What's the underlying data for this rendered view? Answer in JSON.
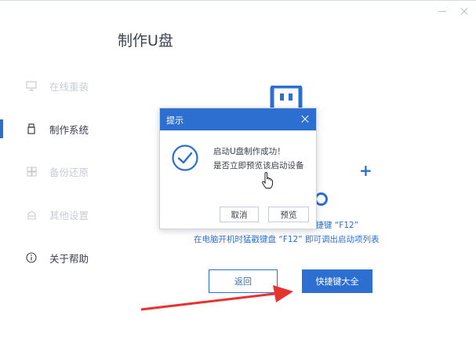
{
  "page": {
    "title": "制作U盘"
  },
  "window": {
    "minimize_icon": "minimize-icon",
    "close_icon": "close-icon"
  },
  "sidebar": {
    "items": [
      {
        "label": "在线重装",
        "icon": "monitor-icon",
        "active": false
      },
      {
        "label": "制作系统",
        "icon": "usb-icon",
        "active": true
      },
      {
        "label": "备份还原",
        "icon": "backup-icon",
        "active": false
      },
      {
        "label": "其他设置",
        "icon": "settings-box-icon",
        "active": false
      },
      {
        "label": "关于帮助",
        "icon": "info-icon",
        "active": false
      }
    ]
  },
  "main": {
    "hint_line1": "快捷键 “F12”",
    "hint_line2": "在电脑开机时猛戳键盘 “F12” 即可调出启动项列表",
    "back_label": "返回",
    "hotkeys_label": "快捷键大全"
  },
  "dialog": {
    "title": "提示",
    "message_line1": "启动U盘制作成功！",
    "message_line2": "是否立即预览该启动设备",
    "cancel_label": "取消",
    "preview_label": "预览"
  },
  "colors": {
    "accent": "#2c6fd1",
    "arrow": "#e8322e"
  }
}
